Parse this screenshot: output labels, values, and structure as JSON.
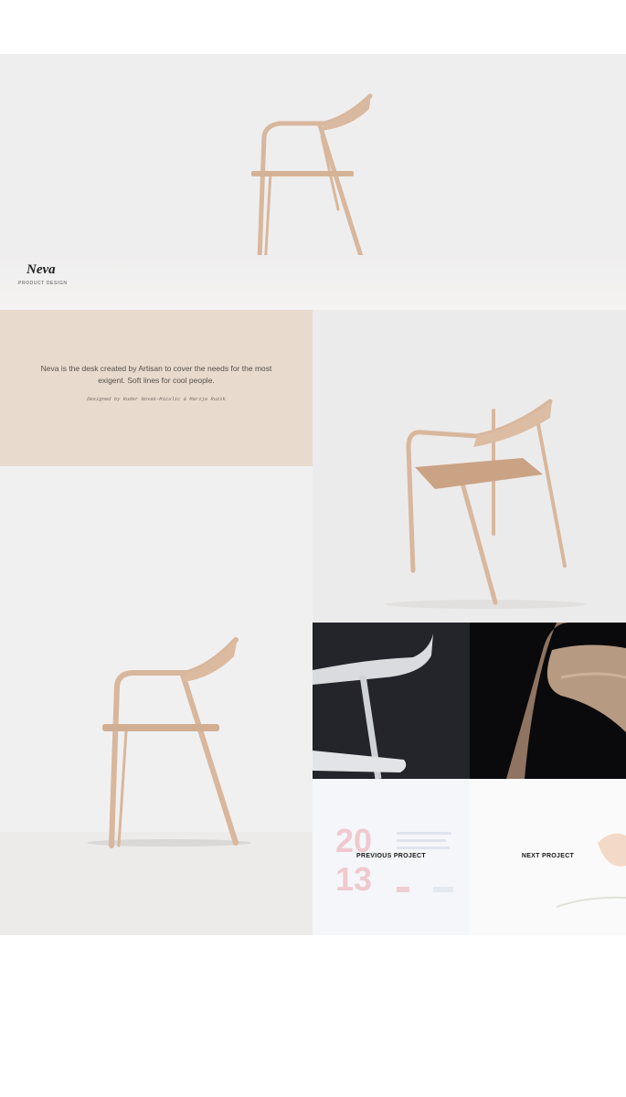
{
  "project": {
    "title": "Neva",
    "subtitle": "PRODUCT DESIGN"
  },
  "description": {
    "text": "Neva is the desk created by Artisan to cover the needs for the most exigent. Soft lines for cool people.",
    "credit": "Designed by Ruder Novak-Miculic & Marija Ruzik"
  },
  "navigation": {
    "previous_label": "PREVIOUS PROJECT",
    "next_label": "NEXT PROJECT"
  },
  "colors": {
    "beige_tile": "#e8dacd",
    "wood": "#d9b9a0",
    "dark_tile": "#1f2127",
    "accent_pink": "#e8a0a8"
  }
}
